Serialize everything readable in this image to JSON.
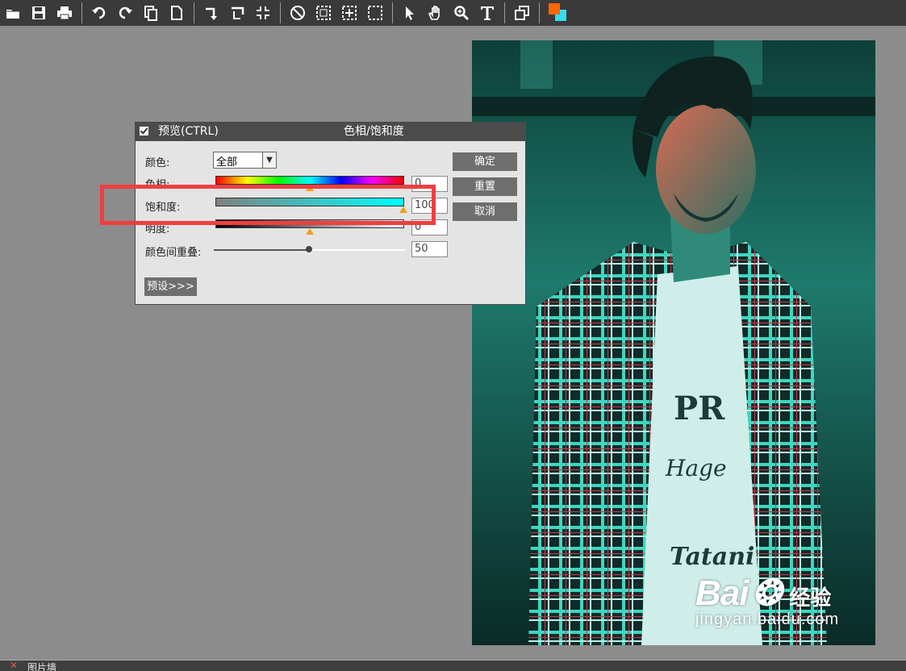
{
  "toolbar": {
    "groups": [
      [
        "open-icon",
        "save-icon",
        "print-icon"
      ],
      [
        "undo-icon",
        "redo-icon",
        "copy-icon",
        "new-page-icon"
      ],
      [
        "rotate-icon",
        "flip-icon",
        "resize-icon"
      ],
      [
        "clear-icon",
        "select-rect-icon",
        "select-center-icon",
        "select-dashed-icon"
      ],
      [
        "pointer-icon",
        "hand-icon",
        "zoom-icon",
        "text-icon"
      ],
      [
        "layers-icon"
      ]
    ],
    "foreground_color": "#ff6600",
    "background_color": "#33ddee"
  },
  "dialog": {
    "preview_label": "预览(CTRL)",
    "title": "色相/饱和度",
    "color_label": "颜色:",
    "color_value": "全部",
    "hue_label": "色相:",
    "hue_value": "0",
    "saturation_label": "饱和度:",
    "saturation_value": "100",
    "lightness_label": "明度:",
    "lightness_value": "0",
    "overlap_label": "颜色间重叠:",
    "overlap_value": "50",
    "ok_label": "确定",
    "reset_label": "重置",
    "cancel_label": "取消",
    "preset_label": "预设>>>"
  },
  "watermark": {
    "logo": "Bai",
    "logo_suffix": "经验",
    "url": "jingyan.baidu.com"
  },
  "bottom_panel": {
    "label": "图片墙"
  },
  "colors": {
    "highlight": "#ef3e42",
    "toolbar_bg": "#3a3a3a",
    "workspace_bg": "#8c8c8c"
  }
}
